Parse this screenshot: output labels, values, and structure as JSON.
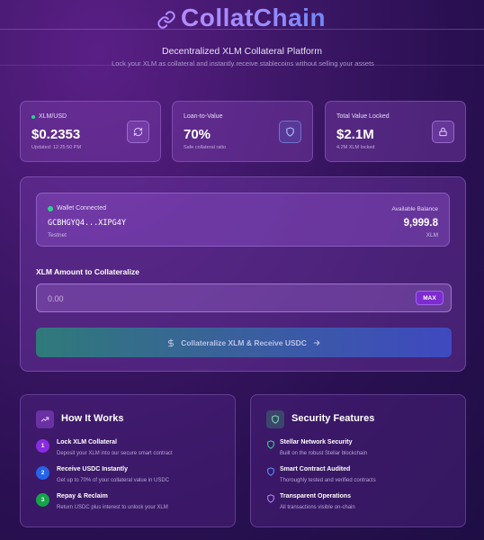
{
  "app": {
    "brand_name": "CollatChain",
    "tagline": "Decentralized XLM Collateral Platform",
    "subtitle": "Lock your XLM as collateral and instantly receive stablecoins without selling your assets"
  },
  "stats": [
    {
      "label": "XLM/USD",
      "value": "$0.2353",
      "sub": "Updated: 12:25:50 PM",
      "icon": "refresh-icon"
    },
    {
      "label": "Loan-to-Value",
      "value": "70%",
      "sub": "Safe collateral ratio",
      "icon": "shield-icon"
    },
    {
      "label": "Total Value Locked",
      "value": "$2.1M",
      "sub": "4.2M XLM locked",
      "icon": "lock-icon"
    }
  ],
  "wallet": {
    "status": "Wallet Connected",
    "address": "GCBHGYQ4...XIPG4Y",
    "network": "Testnet",
    "balance_label": "Available Balance",
    "balance_value": "9,999.8",
    "balance_unit": "XLM"
  },
  "form": {
    "amount_label": "XLM Amount to Collateralize",
    "amount_placeholder": "0.00",
    "amount_value": "",
    "max_label": "MAX",
    "submit_label": "Collateralize XLM & Receive USDC"
  },
  "how_it_works": {
    "title": "How It Works",
    "steps": [
      {
        "num": "1",
        "title": "Lock XLM Collateral",
        "desc": "Deposit your XLM into our secure smart contract"
      },
      {
        "num": "2",
        "title": "Receive USDC Instantly",
        "desc": "Get up to 70% of your collateral value in USDC"
      },
      {
        "num": "3",
        "title": "Repay & Reclaim",
        "desc": "Return USDC plus interest to unlock your XLM"
      }
    ]
  },
  "security": {
    "title": "Security Features",
    "features": [
      {
        "title": "Stellar Network Security",
        "desc": "Built on the robust Stellar blockchain"
      },
      {
        "title": "Smart Contract Audited",
        "desc": "Thoroughly tested and verified contracts"
      },
      {
        "title": "Transparent Operations",
        "desc": "All transactions visible on-chain"
      }
    ]
  },
  "colors": {
    "accent_purple": "#7e2bd0",
    "status_green": "#2fd38b",
    "step1": "#8a2be2",
    "step2": "#2563eb",
    "step3": "#16a34a"
  }
}
